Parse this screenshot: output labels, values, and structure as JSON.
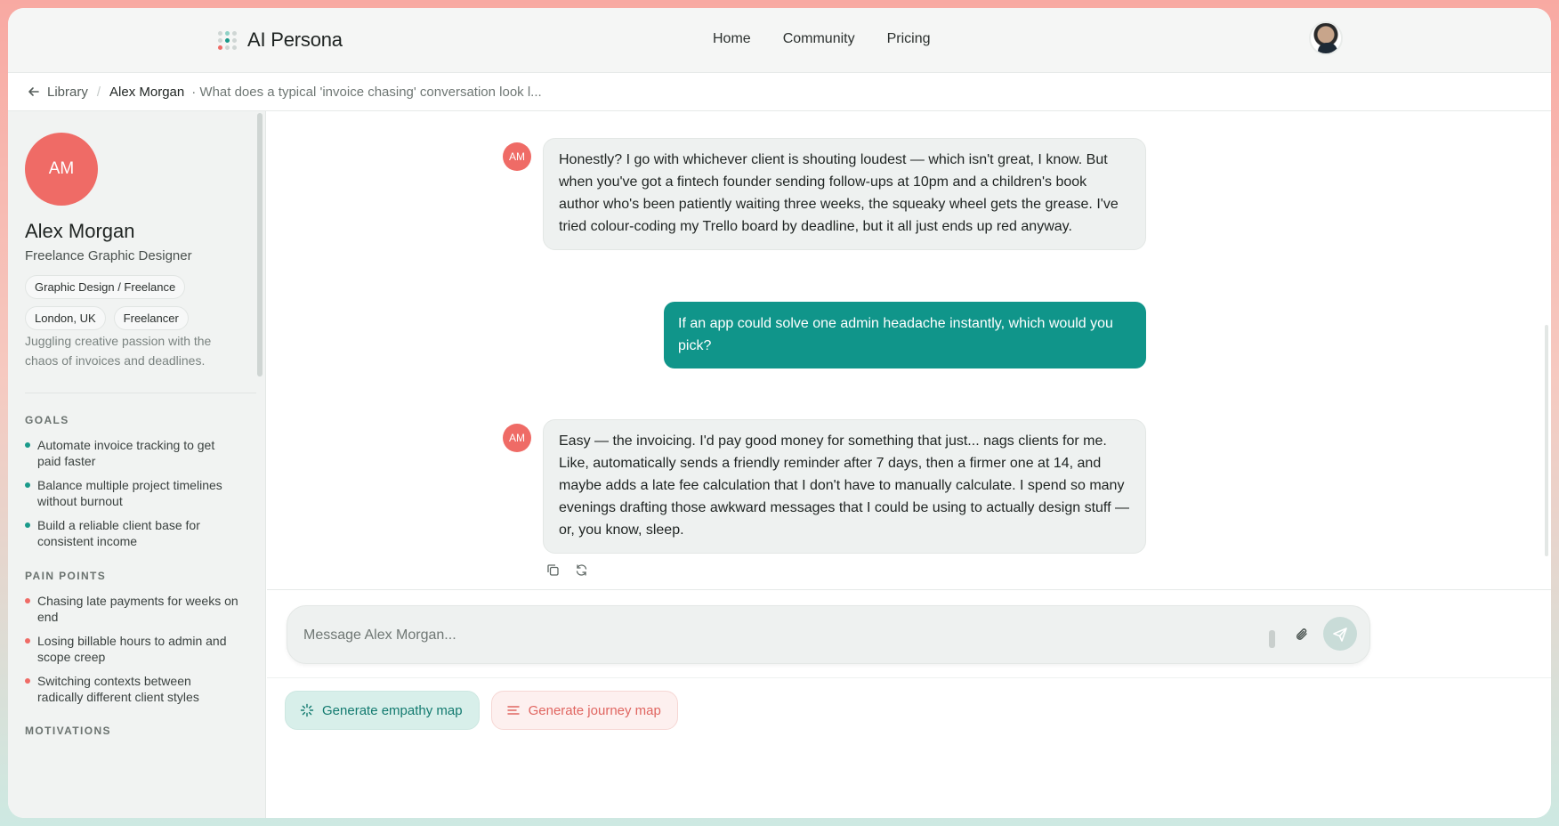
{
  "app": {
    "name": "AI Persona"
  },
  "nav": {
    "links": [
      "Home",
      "Community",
      "Pricing"
    ]
  },
  "breadcrumb": {
    "back_label": "Library",
    "current": "Alex Morgan",
    "description": "· What does a typical 'invoice chasing' conversation look l..."
  },
  "persona": {
    "initials": "AM",
    "name": "Alex Morgan",
    "role": "Freelance Graphic Designer",
    "tags": [
      "Graphic Design / Freelance",
      "London, UK",
      "Freelancer"
    ],
    "bio": "Juggling creative passion with the chaos of invoices and deadlines.",
    "goals_title": "GOALS",
    "goals": [
      "Automate invoice tracking to get paid faster",
      "Balance multiple project timelines without burnout",
      "Build a reliable client base for consistent income"
    ],
    "pain_points_title": "PAIN POINTS",
    "pain_points": [
      "Chasing late payments for weeks on end",
      "Losing billable hours to admin and scope creep",
      "Switching contexts between radically different client styles"
    ],
    "motivations_title": "MOTIVATIONS"
  },
  "messages": [
    {
      "role": "assistant",
      "avatar": "AM",
      "text": "Honestly? I go with whichever client is shouting loudest — which isn't great, I know. But when you've got a fintech founder sending follow-ups at 10pm and a children's book author who's been patiently waiting three weeks, the squeaky wheel gets the grease. I've tried colour-coding my Trello board by deadline, but it all just ends up red anyway."
    },
    {
      "role": "user",
      "text": "If an app could solve one admin headache instantly, which would you pick?"
    },
    {
      "role": "assistant",
      "avatar": "AM",
      "text": "Easy — the invoicing. I'd pay good money for something that just... nags clients for me. Like, automatically sends a friendly reminder after 7 days, then a firmer one at 14, and maybe adds a late fee calculation that I don't have to manually calculate. I spend so many evenings drafting those awkward messages that I could be using to actually design stuff — or, you know, sleep."
    }
  ],
  "composer": {
    "placeholder": "Message Alex Morgan..."
  },
  "actions": {
    "empathy_label": "Generate empathy map",
    "journey_label": "Generate journey map"
  },
  "colors": {
    "accent": "#10958a",
    "persona": "#ef6b66",
    "page_bg": "#ffffff"
  }
}
